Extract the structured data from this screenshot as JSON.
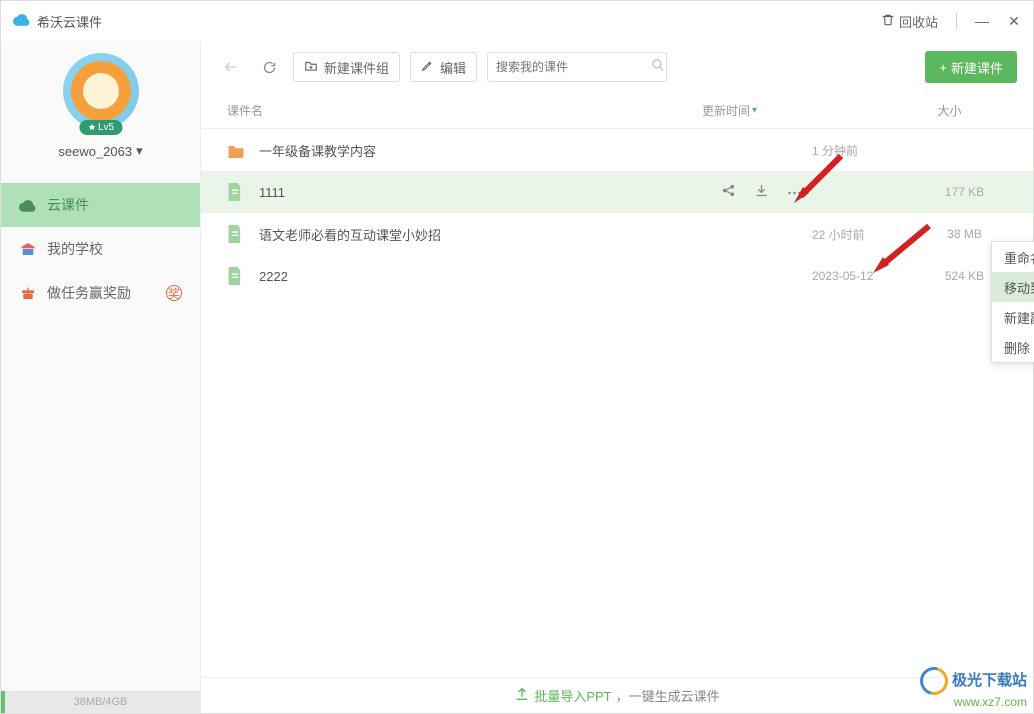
{
  "app": {
    "title": "希沃云课件",
    "recycle": "回收站"
  },
  "user": {
    "name": "seewo_2063",
    "level": "Lv5"
  },
  "nav": {
    "items": [
      {
        "label": "云课件"
      },
      {
        "label": "我的学校"
      },
      {
        "label": "做任务赢奖励",
        "badge": "奖"
      }
    ]
  },
  "storage": {
    "text": "38MB/4GB"
  },
  "toolbar": {
    "new_group": "新建课件组",
    "edit": "编辑",
    "search_placeholder": "搜索我的课件",
    "new_file": "新建课件"
  },
  "columns": {
    "name": "课件名",
    "time": "更新时间",
    "size": "大小"
  },
  "rows": [
    {
      "name": "一年级备课教学内容",
      "time": "1 分钟前",
      "size": "",
      "type": "folder"
    },
    {
      "name": "1111",
      "time": "",
      "size": "177 KB",
      "type": "file",
      "hovered": true
    },
    {
      "name": "语文老师必看的互动课堂小妙招",
      "time": "22 小时前",
      "size": "38 MB",
      "type": "file"
    },
    {
      "name": "2222",
      "time": "2023-05-12",
      "size": "524 KB",
      "type": "file"
    }
  ],
  "menu": {
    "items": [
      {
        "label": "重命名"
      },
      {
        "label": "移动到",
        "hover": true
      },
      {
        "label": "新建副本"
      },
      {
        "label": "删除"
      }
    ]
  },
  "bottom": {
    "import": "批量导入PPT",
    "sub": "，一键生成云课件"
  },
  "watermark": {
    "name": "极光下载站",
    "url": "www.xz7.com"
  }
}
